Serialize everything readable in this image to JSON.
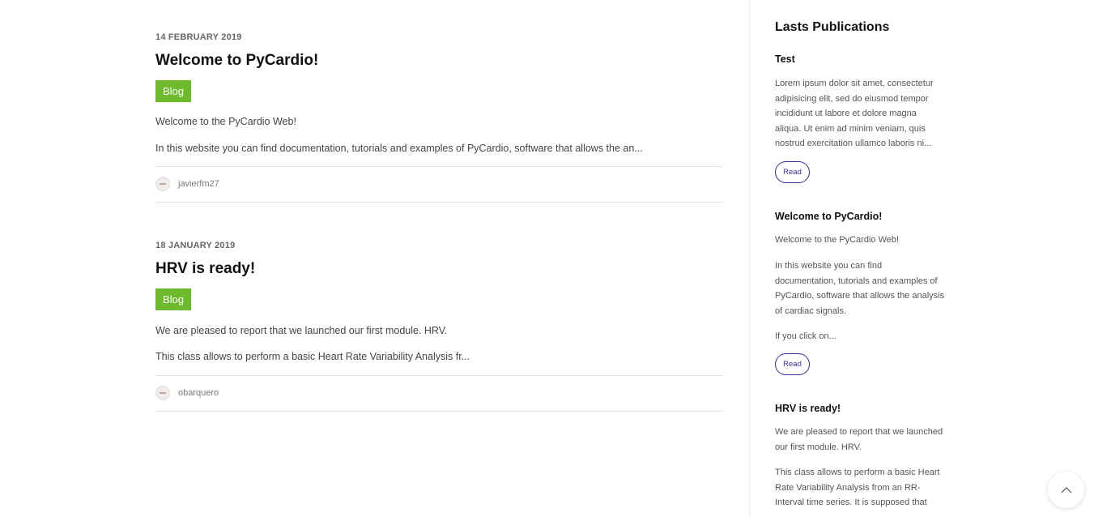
{
  "posts": [
    {
      "date": "14 February 2019",
      "title": "Welcome to PyCardio!",
      "tag": "Blog",
      "paragraphs": [
        "Welcome to the PyCardio Web!",
        "In this website you can find documentation, tutorials and examples of PyCardio, software that allows the an..."
      ],
      "author": "javierfm27"
    },
    {
      "date": "18 January 2019",
      "title": "HRV is ready!",
      "tag": "Blog",
      "paragraphs": [
        "We are pleased to report that we launched our first module. HRV.",
        "This class allows to perform a basic Heart Rate Variability Analysis fr..."
      ],
      "author": "obarquero"
    }
  ],
  "sidebar": {
    "title": "Lasts Publications",
    "items": [
      {
        "title": "Test",
        "paragraphs": [
          "Lorem ipsum dolor sit amet, consectetur adipisicing elit, sed do eiusmod tempor incididunt ut labore et dolore magna aliqua. Ut enim ad minim veniam, quis nostrud exercitation ullamco laboris ni..."
        ],
        "read_label": "Read"
      },
      {
        "title": "Welcome to PyCardio!",
        "paragraphs": [
          "Welcome to the PyCardio Web!",
          "In this website you can find documentation, tutorials and examples of PyCardio, software that allows the analysis of cardiac signals.",
          "If you click on..."
        ],
        "read_label": "Read"
      },
      {
        "title": "HRV is ready!",
        "paragraphs": [
          "We are pleased to report that we launched our first module. HRV.",
          "This class allows to perform a basic Heart Rate Variability Analysis from an RR-Interval time series. It is supposed that"
        ]
      }
    ]
  },
  "colors": {
    "tag": "#6dbb2d",
    "read_border": "#3a2a9a"
  },
  "icons": {
    "back_to_top": "chevron-up-icon",
    "avatar": "avatar"
  }
}
